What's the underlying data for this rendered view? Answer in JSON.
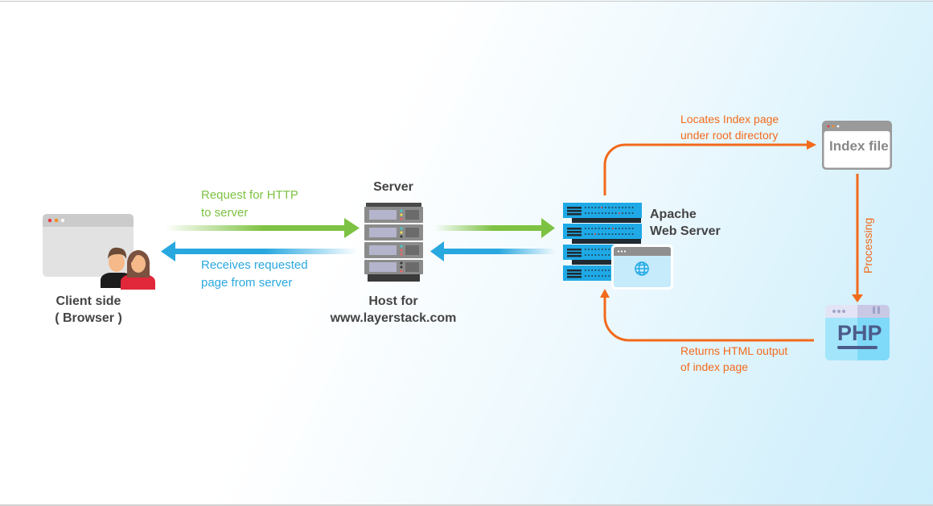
{
  "diagram": {
    "type": "web-request-flow",
    "colors": {
      "request": "#7dc242",
      "response": "#29a8e0",
      "internal": "#f26a1b",
      "node_label": "#444444"
    },
    "nodes": {
      "client": {
        "label_line1": "Client side",
        "label_line2": "( Browser )",
        "icon": "browser-with-users-icon"
      },
      "server": {
        "title": "Server",
        "label_line1": "Host for",
        "label_line2": "www.layerstack.com",
        "icon": "server-rack-icon"
      },
      "apache": {
        "label_line1": "Apache",
        "label_line2": "Web Server",
        "icon": "web-server-icon"
      },
      "index_file": {
        "label": "Index file",
        "icon": "browser-window-icon"
      },
      "php": {
        "label": "PHP",
        "icon": "php-file-icon"
      }
    },
    "edges": {
      "request": {
        "line1": "Request for HTTP",
        "line2": "to server"
      },
      "response": {
        "line1": "Receives requested",
        "line2": "page from server"
      },
      "locate": {
        "line1": "Locates Index page",
        "line2": "under root directory"
      },
      "processing": {
        "label": "Processing"
      },
      "returns": {
        "line1": "Returns HTML output",
        "line2": "of index page"
      }
    }
  }
}
